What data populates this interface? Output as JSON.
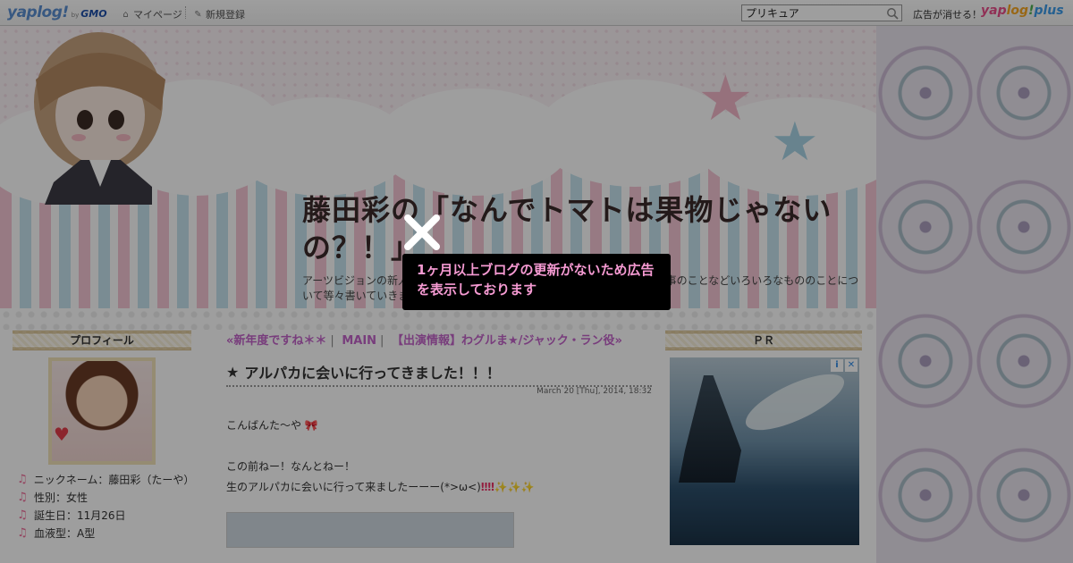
{
  "topbar": {
    "logo": "yaplog!",
    "logo_by": "by",
    "logo_gmo": "GMO",
    "mypage_label": "マイページ",
    "register_label": "新規登録",
    "search_value": "プリキュア",
    "ad_remove_text": "広告が消せる！",
    "plus_logo": [
      "yap",
      "log",
      "!",
      "plus"
    ]
  },
  "header": {
    "blog_title": "藤田彩の「なんでトマトは果物じゃないの？！」",
    "description": "アーツビジョンの新人声優の藤田彩です＊＊日常のことや趣味のこと、お仕事のことなどいろいろなもののことについて等々書いていきます＊＊"
  },
  "sidebar": {
    "profile_title": "プロフィール",
    "profile_items": [
      "ニックネーム：藤田彩（たーや）",
      "性別：女性",
      "誕生日：11月26日",
      "血液型：A型"
    ]
  },
  "entry": {
    "prev_link": "«新年度ですね＊＊",
    "main_link": "MAIN",
    "next_link": "【出演情報】わグルま★/ジャック・ラン役»",
    "title": "アルパカに会いに行ってきました！！！",
    "title_star": "★",
    "date": "March 20 [Thu], 2014, 18:32",
    "line1": "こんばんた～や",
    "line2": "この前ねー！なんとねー！",
    "line3": "生のアルパカに会いに行って来ましたーーー(*>ω<)",
    "line3_marks": "‼‼"
  },
  "right": {
    "pr_title": "ＰＲ",
    "ad_info": "i",
    "ad_close": "✕"
  },
  "overlay": {
    "notice": "1ヶ月以上ブログの更新がないため広告を表示しております"
  },
  "colors": {
    "link_purple": "#c263c9",
    "notice_pink": "#f59ad2",
    "note_pink": "#ee6f9a"
  }
}
